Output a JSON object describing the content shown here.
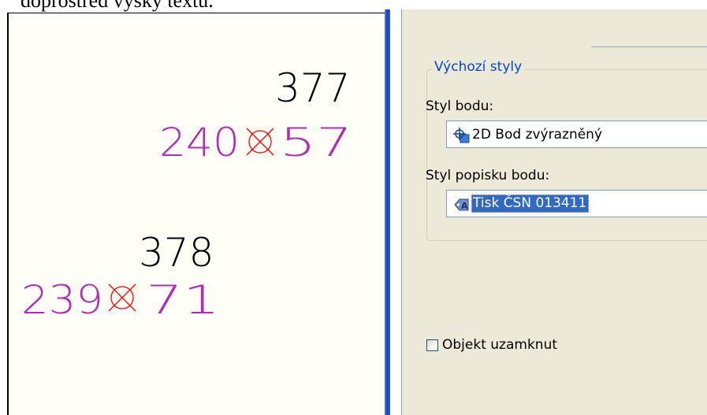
{
  "doc_caption": "doprostřed výšky textu.",
  "cad": {
    "points": [
      {
        "number": "377",
        "left_value": "240",
        "right_value": "57"
      },
      {
        "number": "378",
        "left_value": "239",
        "right_value": "71"
      }
    ],
    "colors": {
      "number": "#000000",
      "values": "#b32bb3",
      "marker": "#ff0000",
      "background": "#fffff7"
    }
  },
  "dialog": {
    "group_title": "Výchozí styly",
    "point_style_label": "Styl bodu:",
    "point_style_value": "2D Bod zvýrazněný",
    "point_style_icon": "point-style-icon",
    "label_style_label": "Styl popisku bodu:",
    "label_style_value": "Tisk ČSN 013411",
    "label_style_icon": "label-style-icon",
    "lock_checkbox_label": "Objekt uzamknut",
    "lock_checked": false,
    "colors": {
      "group_title": "#0046d5",
      "selection": "#316ac5",
      "panel": "#ece9d8",
      "splitter": "#0a3fc8"
    }
  }
}
